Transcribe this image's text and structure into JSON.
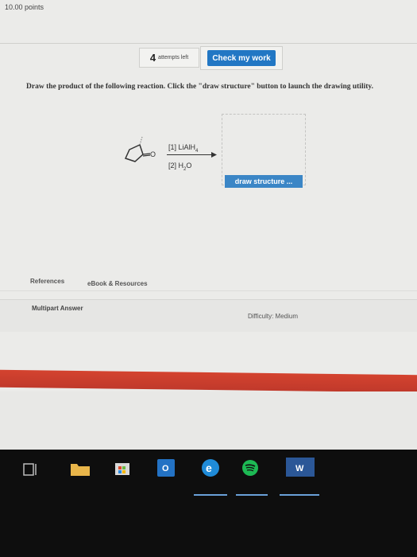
{
  "header": {
    "points": "10.00 points"
  },
  "attempts": {
    "count": "4",
    "label": "attempts left"
  },
  "buttons": {
    "check_my_work": "Check my work",
    "draw_structure": "draw structure ..."
  },
  "question": {
    "text": "Draw the product of the following reaction. Click the \"draw structure\" button to launch the drawing utility."
  },
  "reaction": {
    "oxygen": "O",
    "step1": "[1] LiAlH",
    "step1_sub": "4",
    "step2": "[2] H",
    "step2_sub": "2",
    "step2_end": "O"
  },
  "tabs": {
    "references": "References",
    "ebook": "eBook & Resources"
  },
  "footer": {
    "multipart": "Multipart Answer",
    "difficulty": "Difficulty: Medium"
  },
  "taskbar": {
    "icons": [
      "task-view-icon",
      "file-explorer-icon",
      "store-icon",
      "outlook-icon",
      "edge-icon",
      "spotify-icon",
      "word-icon"
    ],
    "word_label": "W",
    "outlook_label": "O"
  },
  "colors": {
    "accent_blue": "#2277c4",
    "red_bar": "#c0392b",
    "taskbar": "#0e0e0e"
  }
}
